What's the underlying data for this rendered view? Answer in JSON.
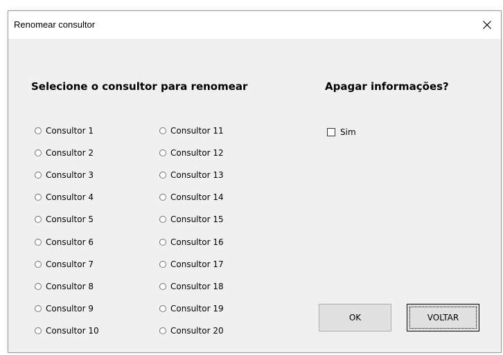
{
  "window": {
    "title": "Renomear consultor"
  },
  "left_heading": "Selecione o consultor para renomear",
  "right_heading": "Apagar informações?",
  "consultants_col1": [
    "Consultor 1",
    "Consultor 2",
    "Consultor 3",
    "Consultor 4",
    "Consultor 5",
    "Consultor 6",
    "Consultor 7",
    "Consultor 8",
    "Consultor 9",
    "Consultor 10"
  ],
  "consultants_col2": [
    "Consultor 11",
    "Consultor 12",
    "Consultor 13",
    "Consultor 14",
    "Consultor 15",
    "Consultor 16",
    "Consultor 17",
    "Consultor 18",
    "Consultor 19",
    "Consultor 20"
  ],
  "checkbox": {
    "label": "Sim",
    "checked": false
  },
  "buttons": {
    "ok": "OK",
    "back": "VOLTAR"
  },
  "icons": {
    "close": "close-icon"
  }
}
